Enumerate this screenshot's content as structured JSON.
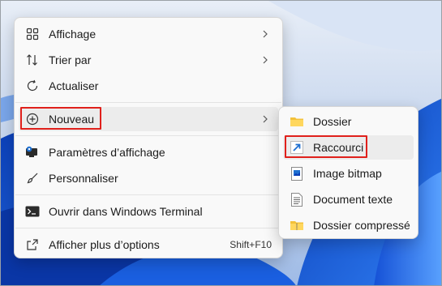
{
  "main_menu": {
    "items": [
      {
        "label": "Affichage",
        "icon": "grid-view-icon",
        "has_submenu": true
      },
      {
        "label": "Trier par",
        "icon": "sort-arrows-icon",
        "has_submenu": true
      },
      {
        "label": "Actualiser",
        "icon": "refresh-icon",
        "has_submenu": false
      },
      {
        "label": "Nouveau",
        "icon": "add-circle-icon",
        "has_submenu": true
      },
      {
        "label": "Paramètres d’affichage",
        "icon": "display-settings-icon",
        "has_submenu": false
      },
      {
        "label": "Personnaliser",
        "icon": "brush-icon",
        "has_submenu": false
      },
      {
        "label": "Ouvrir dans Windows Terminal",
        "icon": "terminal-icon",
        "has_submenu": false
      },
      {
        "label": "Afficher plus d’options",
        "icon": "more-options-icon",
        "shortcut": "Shift+F10"
      }
    ]
  },
  "sub_menu": {
    "items": [
      {
        "label": "Dossier",
        "icon": "folder-icon"
      },
      {
        "label": "Raccourci",
        "icon": "shortcut-arrow-icon"
      },
      {
        "label": "Image bitmap",
        "icon": "bitmap-image-icon"
      },
      {
        "label": "Document texte",
        "icon": "text-document-icon"
      },
      {
        "label": "Dossier compressé",
        "icon": "zip-folder-icon"
      }
    ]
  },
  "colors": {
    "highlight_box": "#e0201b",
    "menu_bg": "#f9f9f9",
    "wallpaper": "#2a6fe0",
    "accent_icon": "#1e6fd0"
  }
}
